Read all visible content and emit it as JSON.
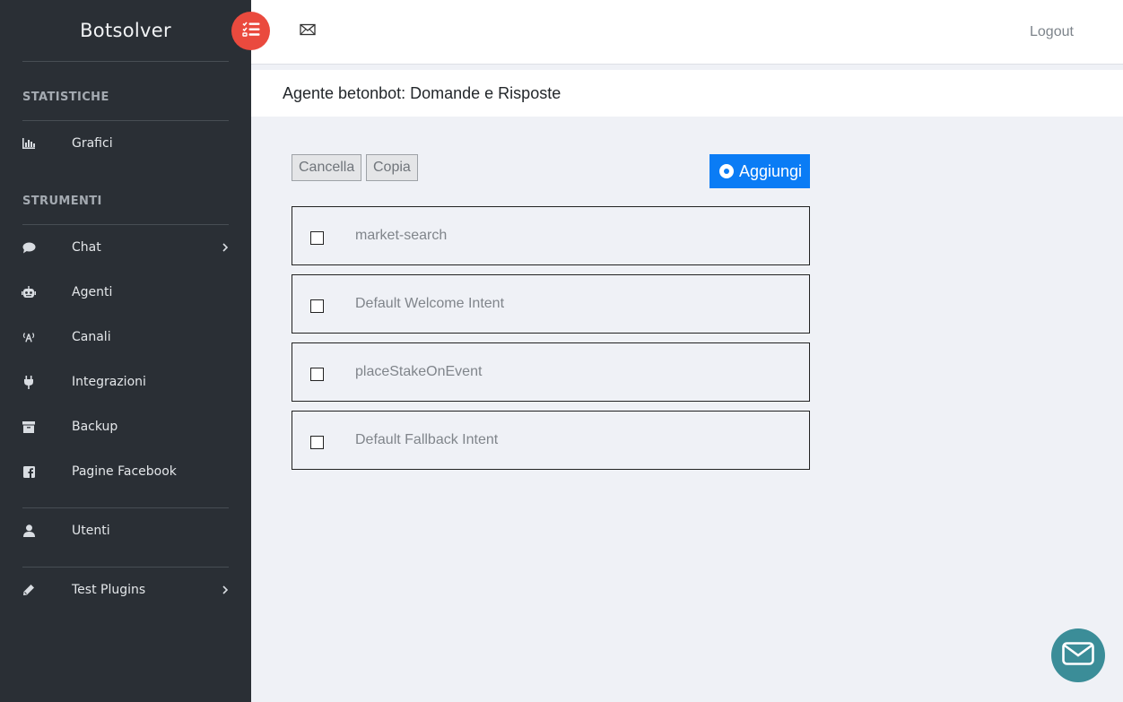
{
  "brand": "Botsolver",
  "header": {
    "logout_label": "Logout"
  },
  "page": {
    "title": "Agente betonbot: Domande e Risposte"
  },
  "sidebar": {
    "sections": [
      {
        "title": "STATISTICHE"
      },
      {
        "title": "STRUMENTI"
      }
    ],
    "items": [
      {
        "label": "Grafici",
        "icon": "bar-chart-icon"
      },
      {
        "label": "Chat",
        "icon": "chat-bubble-icon",
        "has_submenu": true
      },
      {
        "label": "Agenti",
        "icon": "robot-icon"
      },
      {
        "label": "Canali",
        "icon": "broadcast-icon"
      },
      {
        "label": "Integrazioni",
        "icon": "plug-icon"
      },
      {
        "label": "Backup",
        "icon": "archive-icon"
      },
      {
        "label": "Pagine Facebook",
        "icon": "facebook-icon"
      },
      {
        "label": "Utenti",
        "icon": "user-icon"
      },
      {
        "label": "Test Plugins",
        "icon": "pencil-icon",
        "has_submenu": true
      }
    ]
  },
  "actions": {
    "delete_label": "Cancella",
    "copy_label": "Copia",
    "add_label": "Aggiungi"
  },
  "intents": [
    {
      "name": "market-search",
      "checked": false
    },
    {
      "name": "Default Welcome Intent",
      "checked": false
    },
    {
      "name": "placeStakeOnEvent",
      "checked": false
    },
    {
      "name": "Default Fallback Intent",
      "checked": false
    }
  ],
  "colors": {
    "sidebar_bg": "#2a2f35",
    "toggle_button": "#ea4a3e",
    "primary_button": "#0a7cf5",
    "chat_fab": "#3b8d98",
    "content_bg": "#eff1f6"
  }
}
